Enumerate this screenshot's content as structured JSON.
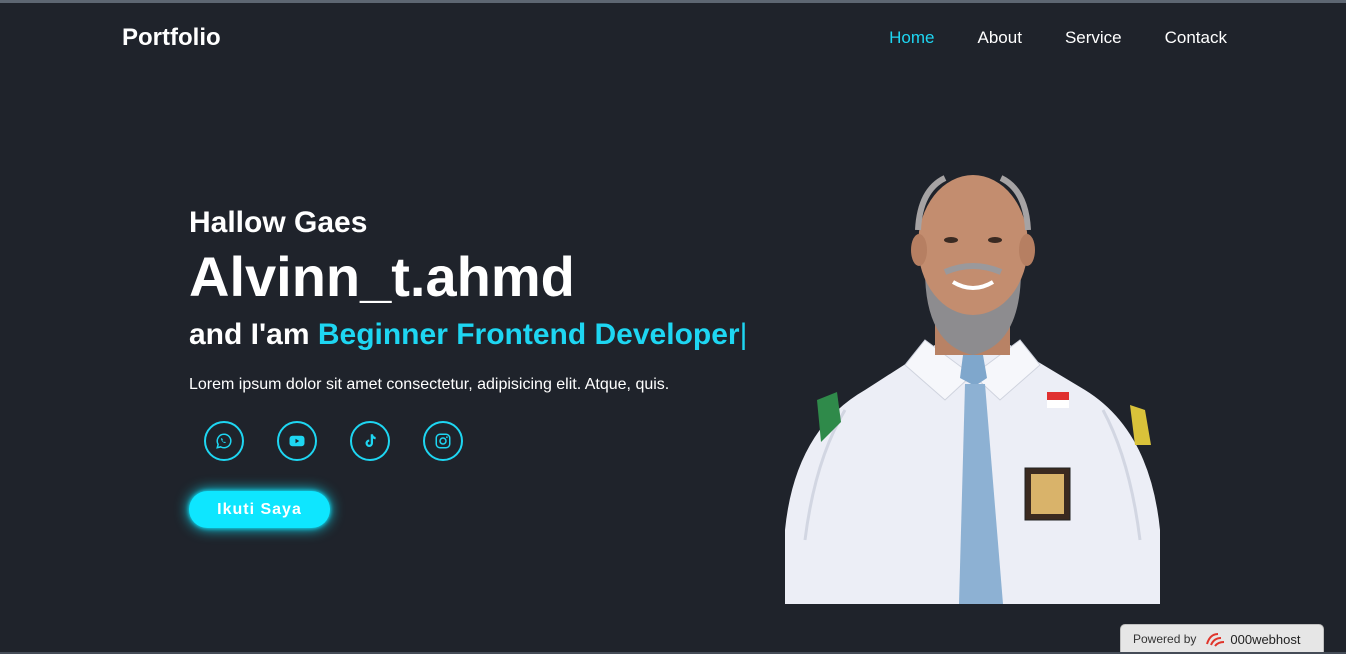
{
  "brand": {
    "logo": "Portfolio"
  },
  "nav": {
    "items": [
      {
        "label": "Home",
        "active": true
      },
      {
        "label": "About"
      },
      {
        "label": "Service"
      },
      {
        "label": "Contack"
      }
    ]
  },
  "hero": {
    "greeting": "Hallow Gaes",
    "name": "Alvinn_t.ahmd",
    "role_prefix": "and I'am ",
    "role_highlight": "Beginner Frontend Developer",
    "role_cursor": "|",
    "description": "Lorem ipsum dolor sit amet consectetur, adipisicing elit. Atque, quis.",
    "cta_label": "Ikuti Saya"
  },
  "socials": [
    {
      "icon": "whatsapp-icon"
    },
    {
      "icon": "youtube-icon"
    },
    {
      "icon": "tiktok-icon"
    },
    {
      "icon": "instagram-icon"
    }
  ],
  "badge": {
    "prefix": "Powered by",
    "brand": "000webhost"
  },
  "colors": {
    "background": "#1f232b",
    "accent": "#1ed6f2",
    "button": "#0ee6ff"
  }
}
